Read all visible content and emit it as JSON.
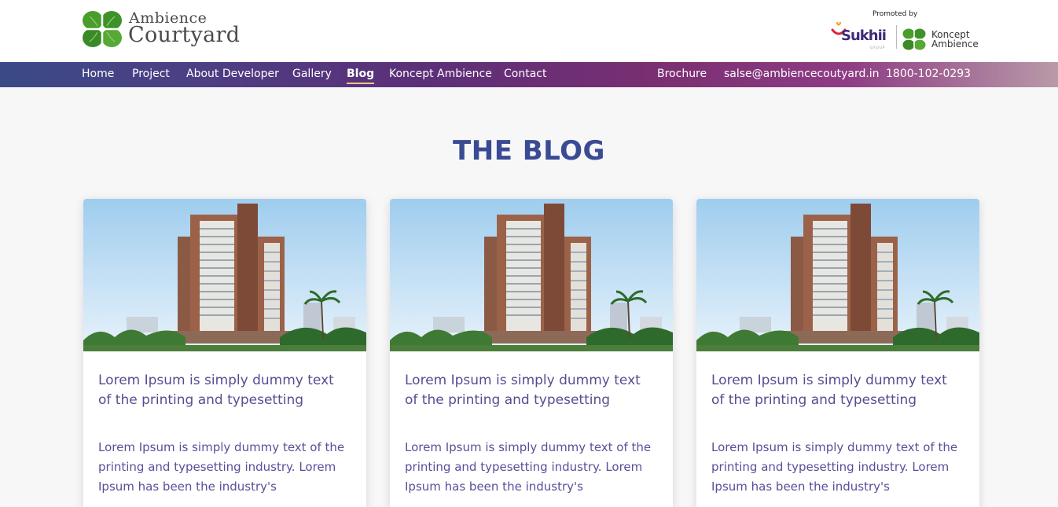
{
  "brand": {
    "name_line1": "Ambience",
    "name_line2": "Courtyard",
    "promoted_by": "Promoted by",
    "partner1": "Sukhii",
    "partner1_sub": "GROUP",
    "partner2_line1": "Koncept",
    "partner2_line2": "Ambience",
    "colors": {
      "leaf": "#3e9b2f",
      "nav_start": "#3a4a87",
      "nav_end": "#b99aa8",
      "title": "#3a4b94",
      "card_text": "#5b4a92",
      "active_underline": "#f0c38a"
    }
  },
  "nav": {
    "items": [
      {
        "label": "Home"
      },
      {
        "label": "Project"
      },
      {
        "label": "About Developer"
      },
      {
        "label": "Gallery"
      },
      {
        "label": "Blog",
        "active": true
      },
      {
        "label": "Koncept Ambience"
      },
      {
        "label": "Contact"
      }
    ],
    "right": [
      {
        "label": "Brochure"
      },
      {
        "label": "salse@ambiencecoutyard.in"
      },
      {
        "label": "1800-102-0293"
      }
    ]
  },
  "page": {
    "title": "THE BLOG"
  },
  "cards": [
    {
      "title": "Lorem Ipsum is simply dummy text of the printing and typesetting",
      "excerpt": "Lorem Ipsum is simply dummy text of the printing and typesetting industry. Lorem Ipsum has been the industry's",
      "image_icon": "building-photo"
    },
    {
      "title": "Lorem Ipsum is simply dummy text of the printing and typesetting",
      "excerpt": "Lorem Ipsum is simply dummy text of the printing and typesetting industry. Lorem Ipsum has been the industry's",
      "image_icon": "building-photo"
    },
    {
      "title": "Lorem Ipsum is simply dummy text of the printing and typesetting",
      "excerpt": "Lorem Ipsum is simply dummy text of the printing and typesetting industry. Lorem Ipsum has been the industry's",
      "image_icon": "building-photo"
    }
  ]
}
